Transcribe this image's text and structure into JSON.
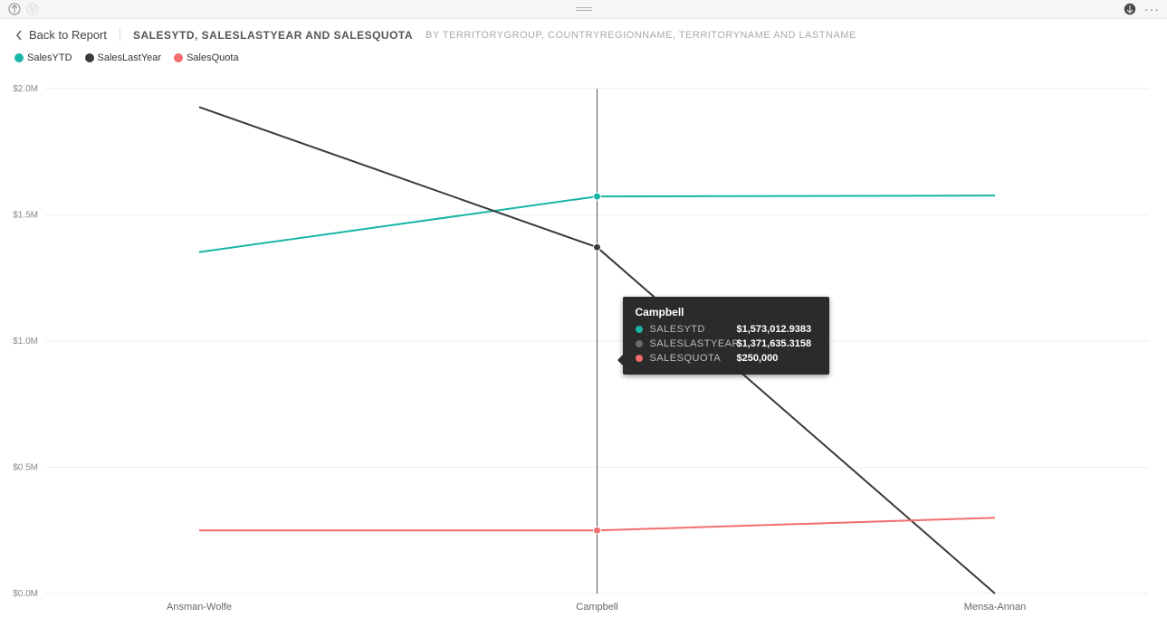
{
  "topbar": {
    "drillup_title": "Drill up",
    "drilldown_title": "Drill down",
    "focus_title": "Focus mode",
    "more_title": "More options"
  },
  "header": {
    "back_label": "Back to Report",
    "title": "SALESYTD, SALESLASTYEAR AND SALESQUOTA",
    "subtitle": "BY TERRITORYGROUP, COUNTRYREGIONNAME, TERRITORYNAME AND LASTNAME"
  },
  "legend": [
    {
      "name": "SalesYTD",
      "color": "#17b6a4"
    },
    {
      "name": "SalesLastYear",
      "color": "#3a3a3a"
    },
    {
      "name": "SalesQuota",
      "color": "#f26d6d"
    }
  ],
  "tooltip": {
    "title": "Campbell",
    "rows": [
      {
        "key": "SALESYTD",
        "val": "$1,573,012.9383",
        "color": "#17b6a4"
      },
      {
        "key": "SALESLASTYEAR",
        "val": "$1,371,635.3158",
        "color": "#6a6a6a"
      },
      {
        "key": "SALESQUOTA",
        "val": "$250,000",
        "color": "#f26d6d"
      }
    ]
  },
  "chart_data": {
    "type": "line",
    "title": "SalesYTD, SalesLastYear and SalesQuota",
    "xlabel": "",
    "ylabel": "",
    "ylim": [
      0,
      2000000
    ],
    "yticks": [
      0,
      500000,
      1000000,
      1500000,
      2000000
    ],
    "ytick_labels": [
      "$0.0M",
      "$0.5M",
      "$1.0M",
      "$1.5M",
      "$2.0M"
    ],
    "categories": [
      "Ansman-Wolfe",
      "Campbell",
      "Mensa-Annan"
    ],
    "series": [
      {
        "name": "SalesYTD",
        "color": "#17b6a4",
        "values": [
          1352577,
          1573013,
          1576562
        ]
      },
      {
        "name": "SalesLastYear",
        "color": "#3a3a3a",
        "values": [
          1927059,
          1371635,
          0
        ]
      },
      {
        "name": "SalesQuota",
        "color": "#f26d6d",
        "values": [
          250000,
          250000,
          300000
        ]
      }
    ],
    "hover_index": 1
  }
}
